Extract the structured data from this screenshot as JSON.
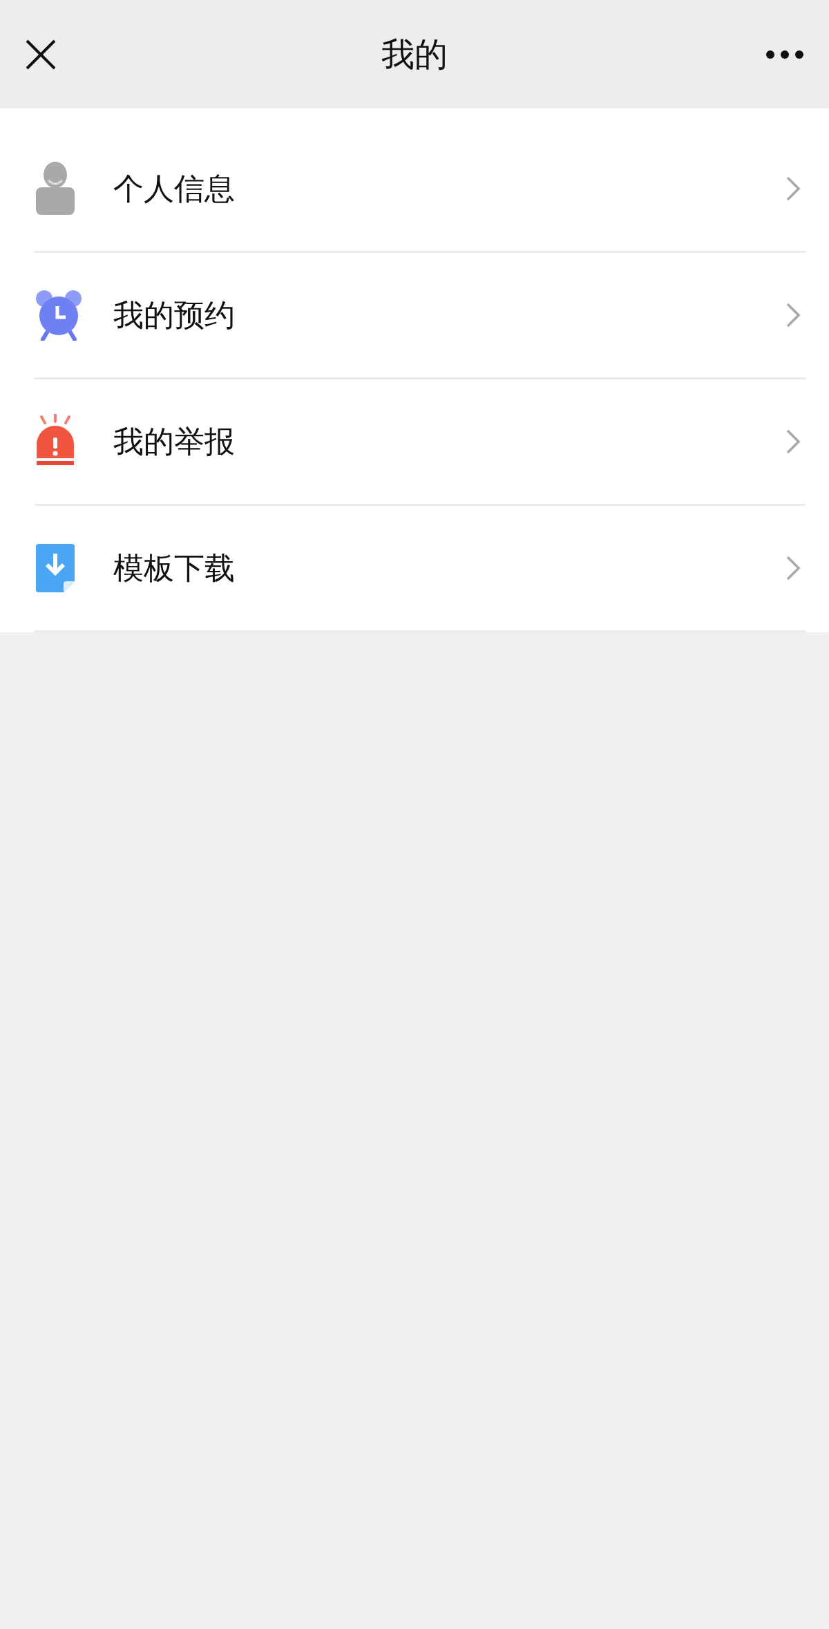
{
  "header": {
    "title": "我的"
  },
  "menu": [
    {
      "kind": "person",
      "label": "个人信息"
    },
    {
      "kind": "clock",
      "label": "我的预约"
    },
    {
      "kind": "alarm",
      "label": "我的举报"
    },
    {
      "kind": "download",
      "label": "模板下载"
    }
  ]
}
